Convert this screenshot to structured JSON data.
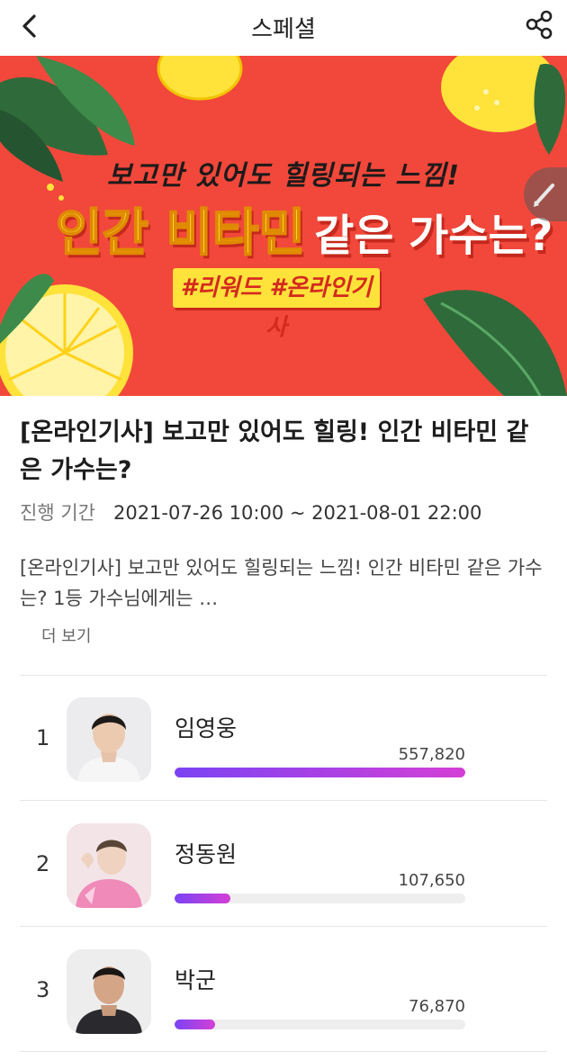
{
  "header": {
    "title": "스페셜",
    "back_icon": "chevron-left-icon",
    "share_icon": "share-icon"
  },
  "banner": {
    "subtitle": "보고만 있어도 힐링되는 느낌!",
    "headline_highlight": "인간 비타민",
    "headline_rest": "같은 가수는?",
    "hashtags": "#리워드 #온라인기사",
    "edit_icon": "pencil-icon",
    "colors": {
      "background": "#f1483b",
      "lemon": "#ffe23a",
      "leaf": "#2f6b3a"
    }
  },
  "post": {
    "title": "[온라인기사] 보고만 있어도 힐링! 인간 비타민 같은 가수는?",
    "period_label": "진행 기간",
    "period_value": "2021-07-26 10:00 ~ 2021-08-01 22:00",
    "description": "[온라인기사] 보고만 있어도 힐링되는 느낌! 인간 비타민 같은 가수는? 1등 가수님에게는 …",
    "more_label": "더 보기"
  },
  "ranking": [
    {
      "rank": "1",
      "name": "임영웅",
      "votes": "557,820",
      "fill": 1.0
    },
    {
      "rank": "2",
      "name": "정동원",
      "votes": "107,650",
      "fill": 0.193
    },
    {
      "rank": "3",
      "name": "박군",
      "votes": "76,870",
      "fill": 0.138
    }
  ],
  "colors": {
    "bar_start": "#7b43f4",
    "bar_end": "#d43fd6",
    "track": "#eeeeef"
  }
}
